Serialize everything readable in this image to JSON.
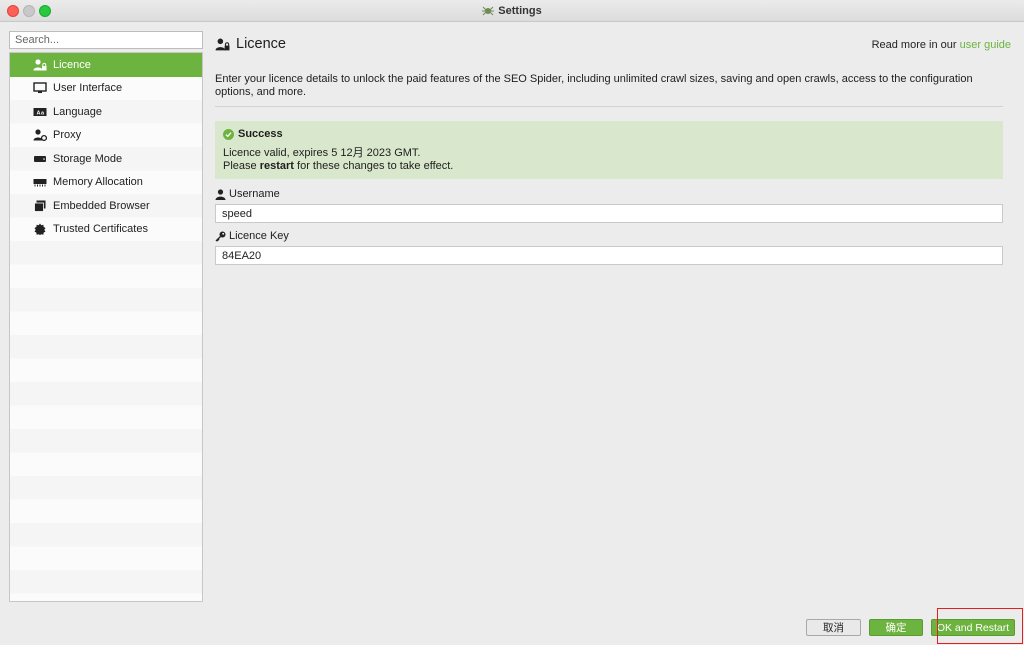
{
  "window": {
    "title": "Settings"
  },
  "search": {
    "placeholder": "Search..."
  },
  "sidebar": {
    "items": [
      {
        "label": "Licence",
        "icon": "user-lock-icon",
        "active": true
      },
      {
        "label": "User Interface",
        "icon": "monitor-icon",
        "active": false
      },
      {
        "label": "Language",
        "icon": "language-icon",
        "active": false
      },
      {
        "label": "Proxy",
        "icon": "user-gear-icon",
        "active": false
      },
      {
        "label": "Storage Mode",
        "icon": "storage-icon",
        "active": false
      },
      {
        "label": "Memory Allocation",
        "icon": "memory-icon",
        "active": false
      },
      {
        "label": "Embedded Browser",
        "icon": "browser-window-icon",
        "active": false
      },
      {
        "label": "Trusted Certificates",
        "icon": "certificate-icon",
        "active": false
      }
    ]
  },
  "main": {
    "title": "Licence",
    "read_more_prefix": "Read more in our",
    "read_more_link": "user guide",
    "description": "Enter your licence details to unlock the paid features of the SEO Spider, including unlimited crawl sizes, saving and open crawls, access to the configuration options, and more.",
    "success": {
      "heading": "Success",
      "line1": "Licence valid, expires 5 12月 2023 GMT.",
      "line2_pre": "Please",
      "line2_bold": "restart",
      "line2_post": "for these changes to take effect."
    },
    "username": {
      "label": "Username",
      "value": "speed"
    },
    "licence_key": {
      "label": "Licence Key",
      "value": "84EA20"
    }
  },
  "buttons": {
    "cancel": "取消",
    "ok": "确定",
    "ok_restart": "OK and Restart"
  },
  "colors": {
    "accent": "#6db33f",
    "success_bg": "#d9e7cc",
    "highlight": "#e02020"
  }
}
